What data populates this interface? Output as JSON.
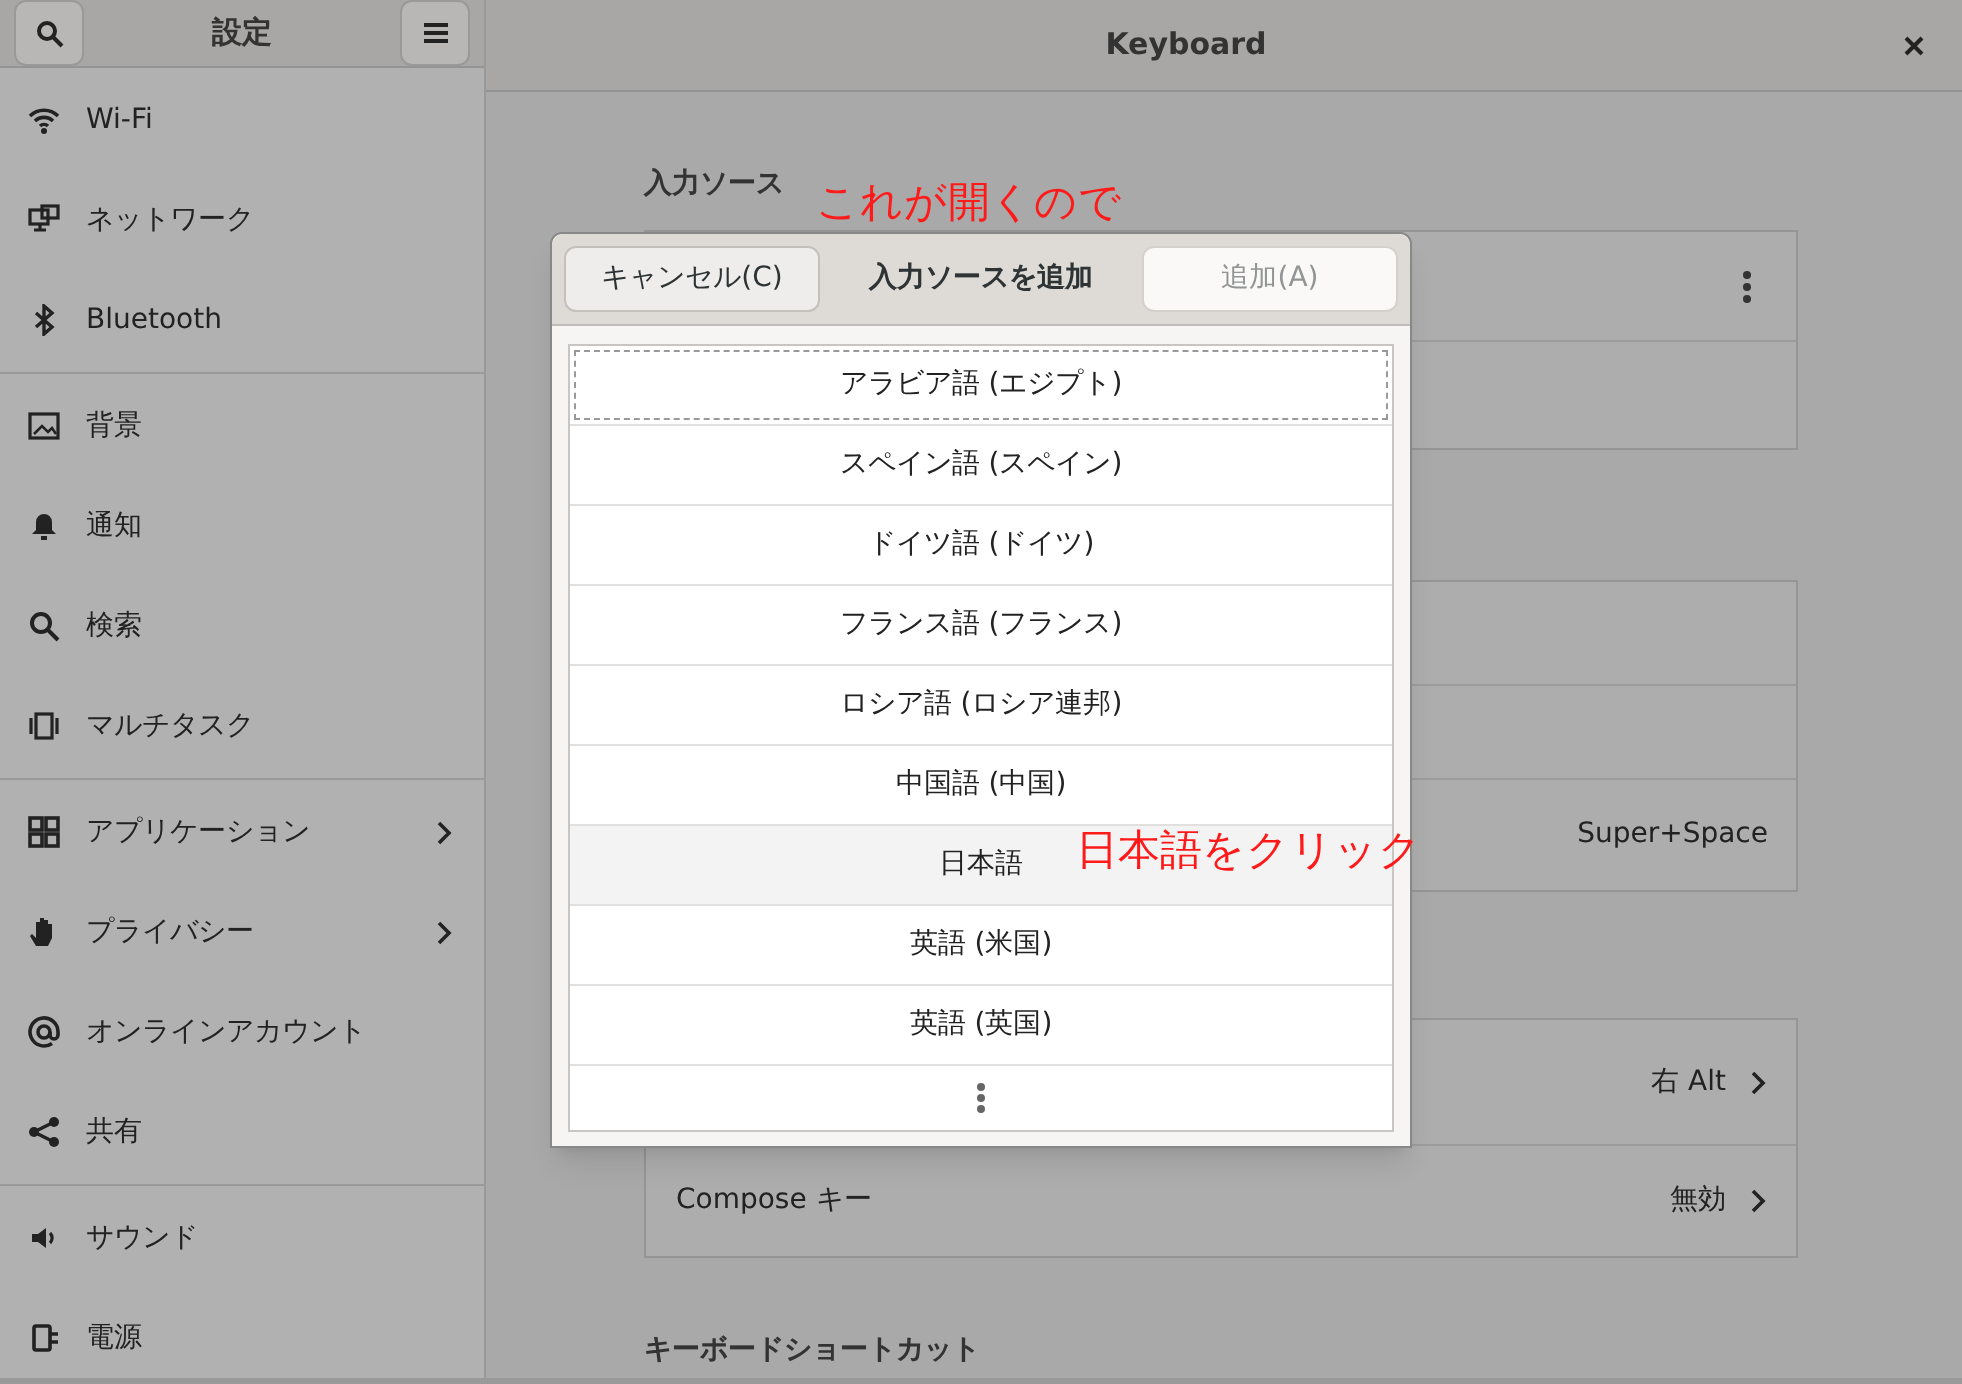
{
  "sidebar": {
    "title": "設定",
    "groups": [
      [
        {
          "label": "Wi-Fi",
          "submenu": false
        },
        {
          "label": "ネットワーク",
          "submenu": false
        },
        {
          "label": "Bluetooth",
          "submenu": false
        }
      ],
      [
        {
          "label": "背景",
          "submenu": false
        },
        {
          "label": "通知",
          "submenu": false
        },
        {
          "label": "検索",
          "submenu": false
        },
        {
          "label": "マルチタスク",
          "submenu": false
        }
      ],
      [
        {
          "label": "アプリケーション",
          "submenu": true
        },
        {
          "label": "プライバシー",
          "submenu": true
        },
        {
          "label": "オンラインアカウント",
          "submenu": false
        },
        {
          "label": "共有",
          "submenu": false
        }
      ],
      [
        {
          "label": "サウンド",
          "submenu": false
        },
        {
          "label": "電源",
          "submenu": false
        }
      ]
    ]
  },
  "main": {
    "title": "Keyboard",
    "input_sources": {
      "heading": "入力ソース"
    },
    "panel_2": {
      "row_3_value": "Super+Space"
    },
    "panel_3": {
      "rows": [
        {
          "label": "",
          "value": "右 Alt"
        },
        {
          "label": "Compose キー",
          "value": "無効"
        }
      ]
    },
    "shortcuts_heading": "キーボードショートカット"
  },
  "dialog": {
    "cancel": "キャンセル(C)",
    "title": "入力ソースを追加",
    "add": {
      "label": "追加(A)",
      "disabled": true
    },
    "items": [
      {
        "label": "アラビア語 (エジプト)",
        "selected": false,
        "focused": true
      },
      {
        "label": "スペイン語 (スペイン)",
        "selected": false,
        "focused": false
      },
      {
        "label": "ドイツ語 (ドイツ)",
        "selected": false,
        "focused": false
      },
      {
        "label": "フランス語 (フランス)",
        "selected": false,
        "focused": false
      },
      {
        "label": "ロシア語 (ロシア連邦)",
        "selected": false,
        "focused": false
      },
      {
        "label": "中国語 (中国)",
        "selected": false,
        "focused": false
      },
      {
        "label": "日本語",
        "selected": true,
        "focused": false
      },
      {
        "label": "英語 (米国)",
        "selected": false,
        "focused": false
      },
      {
        "label": "英語 (英国)",
        "selected": false,
        "focused": false
      }
    ]
  },
  "annotations": [
    "これが開くので",
    "日本語をクリック"
  ]
}
